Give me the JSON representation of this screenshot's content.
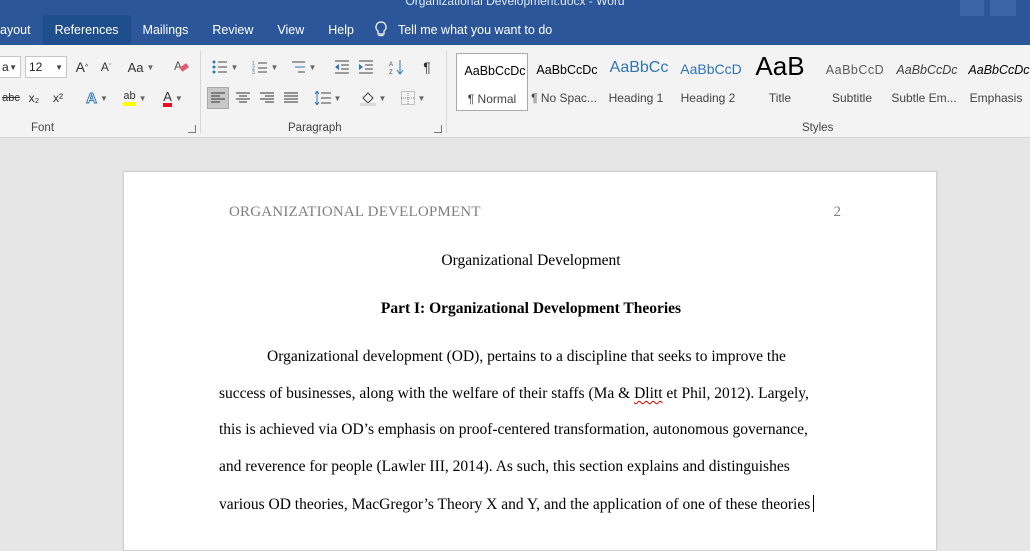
{
  "app": {
    "title_text": "Organizational Development.docx - Word"
  },
  "tabs": [
    {
      "label": "Layout",
      "visible_label": "ayout"
    },
    {
      "label": "References"
    },
    {
      "label": "Mailings"
    },
    {
      "label": "Review"
    },
    {
      "label": "View"
    },
    {
      "label": "Help"
    }
  ],
  "tell_me": {
    "label": "Tell me what you want to do",
    "icon": "lightbulb-icon"
  },
  "font_group": {
    "label": "Font",
    "font_name_value": "a",
    "font_size_value": "12",
    "grow_font": "A",
    "shrink_font": "A",
    "change_case": "Aa",
    "strikethrough": "abc",
    "subscript": "x₂",
    "superscript": "x²",
    "text_effects": "A",
    "highlight": "ab",
    "font_color": "A",
    "colors": {
      "highlight": "#ffff00",
      "font_color": "#e81123",
      "effects": "#2e75b6",
      "clear_formatting": "#e05a6d"
    }
  },
  "paragraph_group": {
    "label": "Paragraph",
    "show_marks": "¶"
  },
  "styles_group": {
    "label": "Styles",
    "items": [
      {
        "sample": "AaBbCcDc",
        "name": "¶ Normal",
        "color": "#000000",
        "selected": true
      },
      {
        "sample": "AaBbCcDc",
        "name": "¶ No Spac...",
        "color": "#000000"
      },
      {
        "sample": "AaBbCc",
        "name": "Heading 1",
        "color": "#2e74b5"
      },
      {
        "sample": "AaBbCcD",
        "name": "Heading 2",
        "color": "#2e74b5"
      },
      {
        "sample": "AaB",
        "name": "Title",
        "color": "#000000"
      },
      {
        "sample": "AaBbCcD",
        "name": "Subtitle",
        "color": "#5a5a5a"
      },
      {
        "sample": "AaBbCcDc",
        "name": "Subtle Em...",
        "color": "#404040"
      },
      {
        "sample": "AaBbCcDc",
        "name": "Emphasis",
        "color": "#000000"
      }
    ]
  },
  "document": {
    "running_head": "ORGANIZATIONAL DEVELOPMENT",
    "page_number": "2",
    "title": "Organizational Development",
    "heading": "Part I: Organizational Development Theories",
    "para_line1": "Organizational development (OD), pertains to a discipline that seeks to improve the",
    "para_line2_pre": "success of businesses, along with the welfare of their staffs (Ma & ",
    "para_line2_error": "Dlitt",
    "para_line2_post": " et Phil, 2012). Largely,",
    "para_line3": "this is achieved via OD’s emphasis on proof-centered transformation, autonomous governance,",
    "para_line4": "and reverence for people (Lawler III, 2014). As such, this section explains and distinguishes",
    "para_line5": "various OD theories, MacGregor’s Theory X and Y, and the application of one of these theories"
  }
}
